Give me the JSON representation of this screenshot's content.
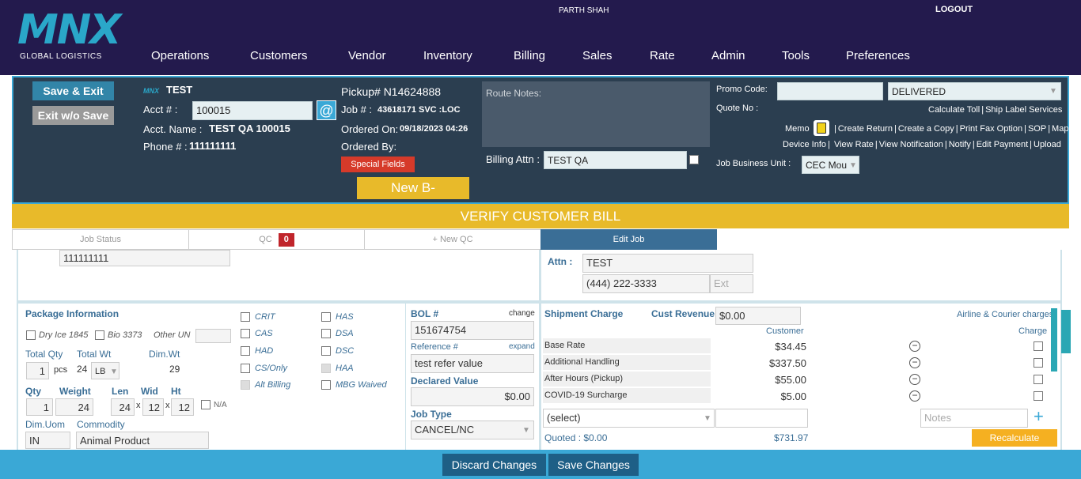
{
  "brand": {
    "logo": "MNX",
    "tagline": "GLOBAL LOGISTICS"
  },
  "user": {
    "name": "PARTH SHAH",
    "logout": "LOGOUT"
  },
  "nav": [
    "Operations",
    "Customers",
    "Vendor",
    "Inventory",
    "Billing",
    "Sales",
    "Rate",
    "Admin",
    "Tools",
    "Preferences"
  ],
  "header": {
    "save_exit": "Save & Exit",
    "exit_wo_save": "Exit w/o Save",
    "acct_brand": "MNX",
    "acct_title": "TEST",
    "acct_label": "Acct # :",
    "acct_value": "100015",
    "at_symbol": "@",
    "acct_name_label": "Acct. Name :",
    "acct_name_value": "TEST QA 100015",
    "phone_label": "Phone # :",
    "phone_value": "111111111",
    "pickup": "Pickup# N14624888",
    "job_label": "Job # :",
    "job_value": "43618171 SVC :LOC",
    "ordered_on_label": "Ordered On:",
    "ordered_on_value": "09/18/2023 04:26",
    "ordered_by_label": "Ordered By:",
    "special_fields": "Special Fields",
    "new_b": "New B-",
    "route_notes": "Route Notes:",
    "billing_attn_label": "Billing Attn :",
    "billing_attn_value": "TEST QA",
    "promo_label": "Promo Code:",
    "status_value": "DELIVERED",
    "quote_label": "Quote No :",
    "links_row1": [
      "Calculate Toll",
      "Ship Label Services"
    ],
    "memo_label": "Memo",
    "links_row2": [
      "Create Return",
      "Create a Copy",
      "Print Fax Option",
      "SOP",
      "Map"
    ],
    "links_row3": [
      "Device Info",
      "View Rate",
      "View Notification",
      "Notify",
      "Edit Payment",
      "Upload"
    ],
    "job_bu_label": "Job Business Unit :",
    "job_bu_value": "CEC Mou"
  },
  "verify_banner": "VERIFY CUSTOMER BILL",
  "tabs": {
    "job_status": "Job Status",
    "qc": "QC",
    "qc_count": "0",
    "new_qc": "+ New QC",
    "edit_job": "Edit Job"
  },
  "contact": {
    "phone_value": "111111111",
    "attn_label": "Attn :",
    "attn_value": "TEST",
    "attn_phone": "(444) 222-3333",
    "ext_placeholder": "Ext"
  },
  "package": {
    "title": "Package Information",
    "dry_ice": "Dry Ice 1845",
    "bio": "Bio 3373",
    "other_un": "Other UN",
    "total_qty_label": "Total Qty",
    "total_wt_label": "Total Wt",
    "dim_wt_label": "Dim.Wt",
    "total_qty_value": "1",
    "pcs": "pcs",
    "total_wt_value": "24",
    "unit": "LB",
    "dim_wt_value": "29",
    "qty_label": "Qty",
    "weight_label": "Weight",
    "len_label": "Len",
    "wid_label": "Wid",
    "ht_label": "Ht",
    "qty_value": "1",
    "weight_value": "24",
    "len_value": "24",
    "wid_value": "12",
    "ht_value": "12",
    "x": "x",
    "na": "N/A",
    "dim_uom_label": "Dim.Uom",
    "commodity_label": "Commodity",
    "dim_uom_value": "IN",
    "commodity_value": "Animal Product"
  },
  "flags": {
    "left": [
      "CRIT",
      "CAS",
      "HAD",
      "CS/Only",
      "Alt Billing"
    ],
    "right": [
      "HAS",
      "DSA",
      "DSC",
      "HAA",
      "MBG Waived"
    ]
  },
  "bol": {
    "bol_label": "BOL #",
    "change": "change",
    "bol_value": "151674754",
    "ref_label": "Reference #",
    "expand": "expand",
    "ref_value": "test refer value",
    "declared_label": "Declared Value",
    "declared_value": "$0.00",
    "job_type_label": "Job Type",
    "job_type_value": "CANCEL/NC"
  },
  "charges": {
    "title": "Shipment Charge",
    "cust_revenue_label": "Cust Revenue",
    "cust_revenue_value": "$0.00",
    "airline_link": "Airline & Courier charges",
    "customer_col": "Customer",
    "charge_col": "Charge",
    "rows": [
      {
        "name": "Base Rate",
        "amount": "$34.45"
      },
      {
        "name": "Additional Handling",
        "amount": "$337.50"
      },
      {
        "name": "After Hours (Pickup)",
        "amount": "$55.00"
      },
      {
        "name": "COVID-19 Surcharge",
        "amount": "$5.00"
      }
    ],
    "select_value": "(select)",
    "notes_placeholder": "Notes",
    "quoted": "Quoted : $0.00",
    "total": "$731.97",
    "recalculate": "Recalculate"
  },
  "footer": {
    "discard": "Discard Changes",
    "save": "Save Changes"
  }
}
